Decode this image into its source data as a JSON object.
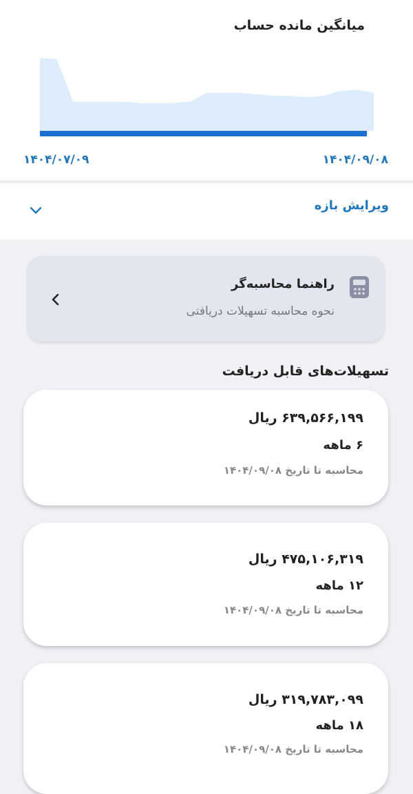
{
  "chart": {
    "title": "میانگین مانده حساب",
    "start_date": "۱۴۰۴/۰۷/۰۹",
    "end_date": "۱۴۰۴/۰۹/۰۸",
    "fill_color": "#deedfb",
    "bar_color": "#1c6fd1"
  },
  "chart_data": {
    "type": "area",
    "title": "میانگین مانده حساب",
    "x_labels": [
      "۱۴۰۴/۰۷/۰۹",
      "۱۴۰۴/۰۹/۰۸"
    ],
    "series": [
      {
        "values": [
          1.0,
          0.98,
          0.4,
          0.4,
          0.4,
          0.4,
          0.38,
          0.38,
          0.38,
          0.4,
          0.52,
          0.52,
          0.52,
          0.5,
          0.48,
          0.48,
          0.46,
          0.48,
          0.55,
          0.56,
          0.52
        ]
      }
    ],
    "grid": false,
    "legend": "none"
  },
  "range": {
    "label": "ویرایش بازه"
  },
  "guide": {
    "title": "راهنما محاسبه‌گر",
    "subtitle": "نحوه محاسبه تسهیلات دریافتی"
  },
  "section": {
    "title": "تسهیلات‌های قابل دریافت"
  },
  "loans": [
    {
      "amount": "۶۳۹,۵۶۶,۱۹۹ ریال",
      "term": "۶ ماهه",
      "date_note": "محاسبه تا تاریخ ۱۴۰۴/۰۹/۰۸"
    },
    {
      "amount": "۴۷۵,۱۰۶,۳۱۹ ریال",
      "term": "۱۲ ماهه",
      "date_note": "محاسبه تا تاریخ ۱۴۰۴/۰۹/۰۸"
    },
    {
      "amount": "۳۱۹,۷۸۳,۰۹۹ ریال",
      "term": "۱۸ ماهه",
      "date_note": "محاسبه تا تاریخ ۱۴۰۴/۰۹/۰۸"
    }
  ]
}
